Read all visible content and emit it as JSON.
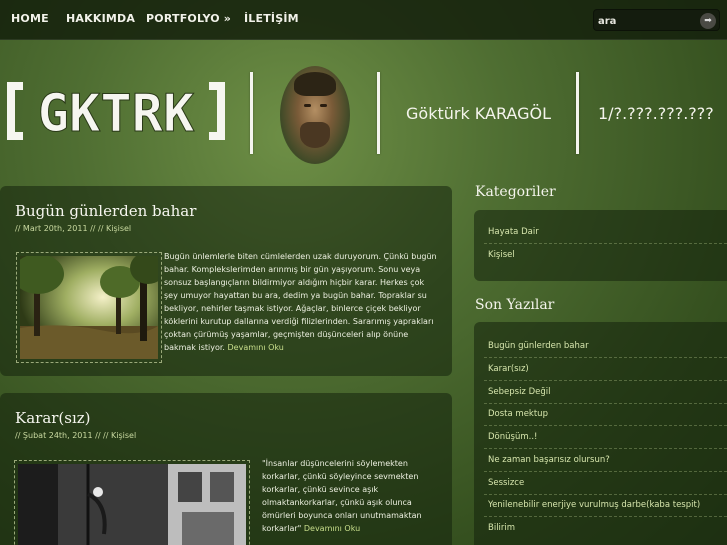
{
  "nav": {
    "items": [
      "HOME",
      "HAKKIMDA",
      "PORTFOLYO »",
      "İLETİŞİM"
    ],
    "search_value": "ara",
    "search_go_glyph": "➡"
  },
  "header": {
    "logo_text": "GKTRK",
    "name": "Göktürk KARAGÖL",
    "phone": "1/?.???.???.???"
  },
  "posts": [
    {
      "title": "Bugün günlerden bahar",
      "date": "// Mart 20th, 2011",
      "sep": " // // ",
      "category": "Kişisel",
      "excerpt": "Bugün ünlemlerle biten cümlelerden uzak duruyorum. Çünkü bugün bahar. Komplekslerimden arınmış bir gün yaşıyorum. Sonu veya sonsuz başlangıçların bildirmiyor aldığım hiçbir karar. Herkes çok şey umuyor hayattan bu ara, dedim ya bugün bahar. Topraklar su bekliyor, nehirler taşmak istiyor. Ağaçlar, binlerce çiçek bekliyor köklerini kurutup dallarına verdiği filizlerinden. Sararımış yaprakları çoktan çürümüş yaşamlar, geçmişten düşünceleri alıp önüne bakmak istiyor. ",
      "more": "Devamını Oku"
    },
    {
      "title": "Karar(sız)",
      "date": "// Şubat 24th, 2011",
      "sep": " // // ",
      "category": "Kişisel",
      "excerpt": "\"İnsanlar düşüncelerini söylemekten korkarlar, çünkü söyleyince sevmekten korkarlar, çünkü sevince aşık olmaktankorkarlar, çünkü aşık olunca ömürleri boyunca onları unutmamaktan korkarlar\" ",
      "more": "Devamını Oku"
    }
  ],
  "sidebar": {
    "categories_title": "Kategoriler",
    "categories": [
      "Hayata Dair",
      "Kişisel"
    ],
    "recent_title": "Son Yazılar",
    "recent": [
      "Bugün günlerden bahar",
      "Karar(sız)",
      "Sebepsiz Değil",
      "Dosta mektup",
      "Dönüşüm..!",
      "Ne zaman başarısız olursun?",
      "Sessizce",
      "Yenilenebilir enerjiye vurulmuş darbe(kaba tespit)",
      "Bilirim"
    ]
  },
  "colors": {
    "background": "#4f6e32",
    "nav_bg": "#14200c",
    "link": "#d7e6ad",
    "accent_more": "#c9df8c"
  }
}
